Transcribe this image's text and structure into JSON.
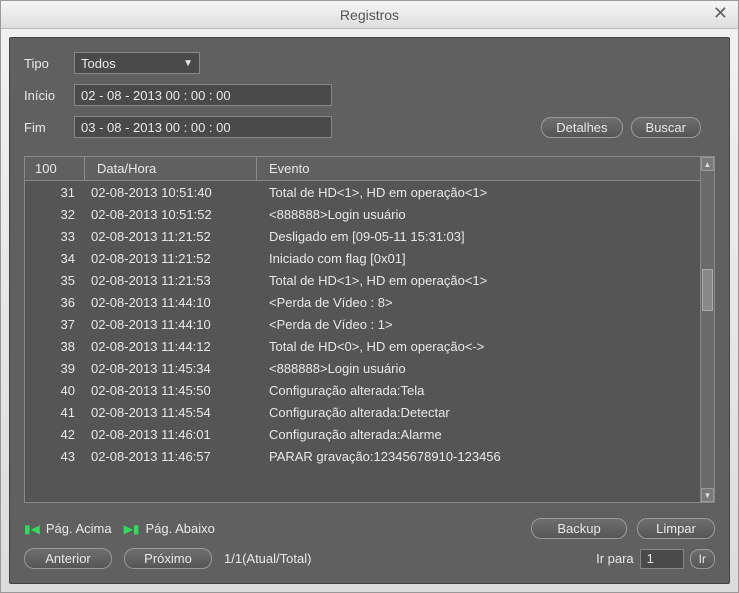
{
  "window": {
    "title": "Registros"
  },
  "filters": {
    "type_label": "Tipo",
    "type_value": "Todos",
    "start_label": "Início",
    "start_value": "02 - 08 - 2013   00 : 00 : 00",
    "end_label": "Fim",
    "end_value": "03 - 08 - 2013   00 : 00 : 00"
  },
  "buttons": {
    "details": "Detalhes",
    "search": "Buscar",
    "backup": "Backup",
    "clear": "Limpar",
    "prev": "Anterior",
    "next": "Próximo",
    "go": "Ir"
  },
  "table": {
    "total": "100",
    "col_datetime": "Data/Hora",
    "col_event": "Evento",
    "rows": [
      {
        "n": "31",
        "dt": "02-08-2013  10:51:40",
        "ev": "Total de HD<1>, HD em operação<1>"
      },
      {
        "n": "32",
        "dt": "02-08-2013  10:51:52",
        "ev": "<888888>Login usuário"
      },
      {
        "n": "33",
        "dt": "02-08-2013  11:21:52",
        "ev": "Desligado em [09-05-11 15:31:03]"
      },
      {
        "n": "34",
        "dt": "02-08-2013  11:21:52",
        "ev": "Iniciado com flag [0x01]"
      },
      {
        "n": "35",
        "dt": "02-08-2013  11:21:53",
        "ev": "Total de HD<1>, HD em operação<1>"
      },
      {
        "n": "36",
        "dt": "02-08-2013  11:44:10",
        "ev": "<Perda de Vídeo : 8>"
      },
      {
        "n": "37",
        "dt": "02-08-2013  11:44:10",
        "ev": "<Perda de Vídeo : 1>"
      },
      {
        "n": "38",
        "dt": "02-08-2013  11:44:12",
        "ev": "Total de HD<0>, HD em operação<->"
      },
      {
        "n": "39",
        "dt": "02-08-2013  11:45:34",
        "ev": "<888888>Login usuário"
      },
      {
        "n": "40",
        "dt": "02-08-2013  11:45:50",
        "ev": "Configuração alterada:Tela"
      },
      {
        "n": "41",
        "dt": "02-08-2013  11:45:54",
        "ev": "Configuração alterada:Detectar"
      },
      {
        "n": "42",
        "dt": "02-08-2013  11:46:01",
        "ev": "Configuração alterada:Alarme"
      },
      {
        "n": "43",
        "dt": "02-08-2013  11:46:57",
        "ev": "PARAR gravação:12345678910-123456"
      }
    ]
  },
  "pager": {
    "page_up": "Pág. Acima",
    "page_down": "Pág. Abaixo",
    "page_info": "1/1(Atual/Total)",
    "goto_label": "Ir para",
    "goto_value": "1"
  }
}
